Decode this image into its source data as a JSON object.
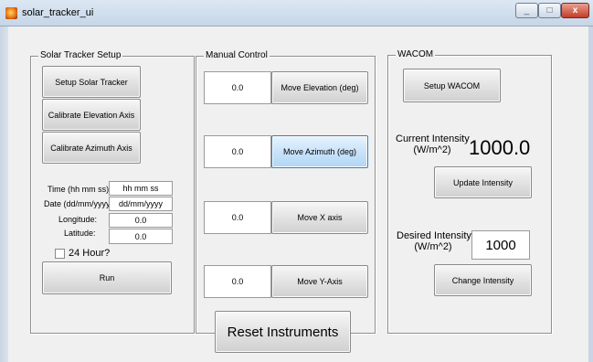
{
  "window": {
    "title": "solar_tracker_ui",
    "btn_min": "_",
    "btn_max": "□",
    "btn_close": "x"
  },
  "setup_panel": {
    "title": "Solar Tracker Setup",
    "setup_button": "Setup Solar Tracker",
    "calib_elev_button": "Calibrate Elevation Axis",
    "calib_az_button": "Calibrate Azimuth Axis",
    "time_label": "Time (hh mm ss):",
    "time_value": "hh mm ss",
    "date_label": "Date (dd/mm/yyyy):",
    "date_value": "dd/mm/yyyy",
    "longitude_label": "Longitude:",
    "longitude_value": "0.0",
    "latitude_label": "Latitude:",
    "latitude_value": "0.0",
    "hour24_label": "24 Hour?",
    "run_button": "Run"
  },
  "manual_panel": {
    "title": "Manual Control",
    "elevation_value": "0.0",
    "elevation_button": "Move Elevation (deg)",
    "azimuth_value": "0.0",
    "azimuth_button": "Move Azimuth (deg)",
    "x_value": "0.0",
    "x_button": "Move X axis",
    "y_value": "0.0",
    "y_button": "Move Y-Axis"
  },
  "wacom_panel": {
    "title": "WACOM",
    "setup_button": "Setup WACOM",
    "current_label_1": "Current Intensity",
    "current_label_2": "(W/m^2)",
    "current_value": "1000.0",
    "update_button": "Update Intensity",
    "desired_label_1": "Desired Intensity",
    "desired_label_2": "(W/m^2)",
    "desired_value": "1000",
    "change_button": "Change Intensity"
  },
  "reset_button": "Reset Instruments"
}
